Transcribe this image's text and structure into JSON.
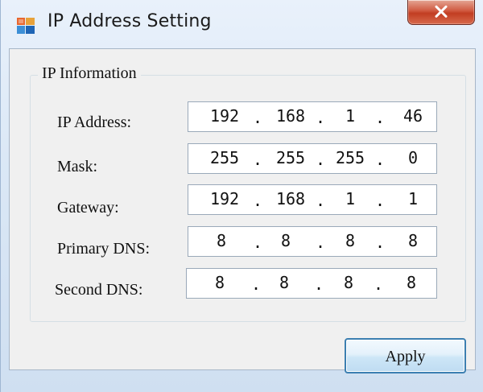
{
  "window": {
    "title": "IP Address Setting",
    "app_icon": "network-settings-icon",
    "close_icon": "close-x-icon"
  },
  "group": {
    "legend": "IP Information"
  },
  "fields": [
    {
      "label": "IP Address:",
      "octets": [
        "192",
        "168",
        "1",
        "46"
      ]
    },
    {
      "label": "Mask:",
      "octets": [
        "255",
        "255",
        "255",
        "0"
      ]
    },
    {
      "label": "Gateway:",
      "octets": [
        "192",
        "168",
        "1",
        "1"
      ]
    },
    {
      "label": "Primary DNS:",
      "octets": [
        "8",
        "8",
        "8",
        "8"
      ]
    },
    {
      "label": "Second DNS:",
      "octets": [
        "8",
        "8",
        "8",
        "8"
      ]
    }
  ],
  "dot": ".",
  "buttons": {
    "apply_label": "Apply"
  },
  "colors": {
    "close_button": "#c8452a",
    "apply_border": "#3c7fb1"
  }
}
